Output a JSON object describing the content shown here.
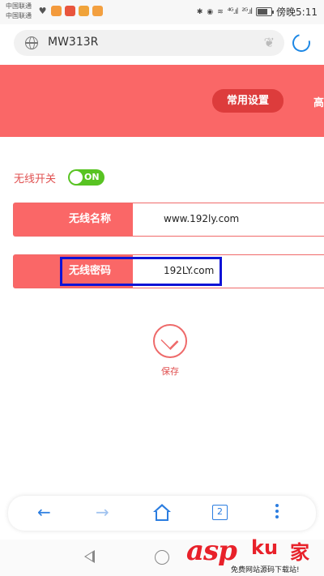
{
  "status_bar": {
    "carrier_1": "中国联通",
    "carrier_2": "中国联通",
    "signal_1": "⁴ᴳ.ıl",
    "signal_2": "²ᴳ.ıl",
    "time": "傍晚5:11"
  },
  "browser": {
    "url": "MW313R",
    "tabs_count": "2"
  },
  "header": {
    "tab_common": "常用设置",
    "tab_advanced": "高"
  },
  "wireless": {
    "switch_label": "无线开关",
    "switch_state": "ON",
    "name_label": "无线名称",
    "name_value": "www.192ly.com",
    "password_label": "无线密码",
    "password_value": "192LY.com"
  },
  "actions": {
    "save_label": "保存"
  },
  "watermark": {
    "brand_1": "asp",
    "brand_2": "ku",
    "brand_3": "家",
    "tagline": "免费网站源码下载站!"
  },
  "colors": {
    "accent": "#fa6767",
    "active_tab": "#dd3c3c",
    "toggle_on": "#58c322",
    "highlight": "#0f13d6",
    "browser_blue": "#2b7de0"
  },
  "icons": {
    "url_bar_left": "globe-icon",
    "url_bar_right": "paw-icon",
    "refresh": "refresh-icon",
    "save": "check-icon"
  }
}
